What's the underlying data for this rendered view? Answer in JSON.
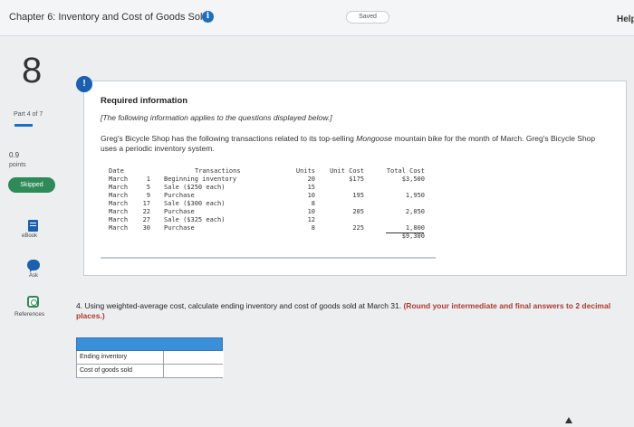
{
  "header": {
    "chapter_title": "Chapter 6: Inventory and Cost of Goods Sold",
    "info_icon": "info-icon",
    "saved_label": "Saved",
    "help_label": "Help"
  },
  "sidebar": {
    "question_number": "8",
    "part_label": "Part 4 of 7",
    "points_value": "0.9",
    "points_label": "points",
    "status_label": "Skipped",
    "ebook_label": "eBook",
    "ask_label": "Ask",
    "references_label": "References"
  },
  "required": {
    "alert_icon_text": "!",
    "title": "Required information",
    "note": "[The following information applies to the questions displayed below.]",
    "desc_part1": "Greg's Bicycle Shop has the following transactions related to its top-selling ",
    "desc_italic": "Mongoose",
    "desc_part2": " mountain bike for the month of March. Greg's Bicycle Shop uses a periodic inventory system."
  },
  "transactions": {
    "headers": {
      "date": "Date",
      "desc": "Transactions",
      "units": "Units",
      "unit_cost": "Unit Cost",
      "total_cost": "Total Cost"
    },
    "rows": [
      {
        "month": "March",
        "day": "1",
        "desc": "Beginning inventory",
        "units": "20",
        "unit_cost": "$175",
        "total_cost": "$3,500"
      },
      {
        "month": "March",
        "day": "5",
        "desc": "Sale ($250 each)",
        "units": "15",
        "unit_cost": "",
        "total_cost": ""
      },
      {
        "month": "March",
        "day": "9",
        "desc": "Purchase",
        "units": "10",
        "unit_cost": "195",
        "total_cost": "1,950"
      },
      {
        "month": "March",
        "day": "17",
        "desc": "Sale ($300 each)",
        "units": "8",
        "unit_cost": "",
        "total_cost": ""
      },
      {
        "month": "March",
        "day": "22",
        "desc": "Purchase",
        "units": "10",
        "unit_cost": "205",
        "total_cost": "2,050"
      },
      {
        "month": "March",
        "day": "27",
        "desc": "Sale ($325 each)",
        "units": "12",
        "unit_cost": "",
        "total_cost": ""
      },
      {
        "month": "March",
        "day": "30",
        "desc": "Purchase",
        "units": "8",
        "unit_cost": "225",
        "total_cost": "1,800"
      }
    ],
    "grand_total": "$9,300"
  },
  "question": {
    "text": "4. Using weighted-average cost, calculate ending inventory and cost of goods sold at March 31. ",
    "instruction": "(Round your intermediate and final answers to 2 decimal places.)"
  },
  "answer_table": {
    "rows": [
      {
        "label": "Ending inventory",
        "value": ""
      },
      {
        "label": "Cost of goods sold",
        "value": ""
      }
    ]
  },
  "colors": {
    "accent": "#1a5fb0",
    "skipped": "#2e8b57",
    "table_header": "#3b8ed8",
    "instruction": "#b03a2e"
  }
}
